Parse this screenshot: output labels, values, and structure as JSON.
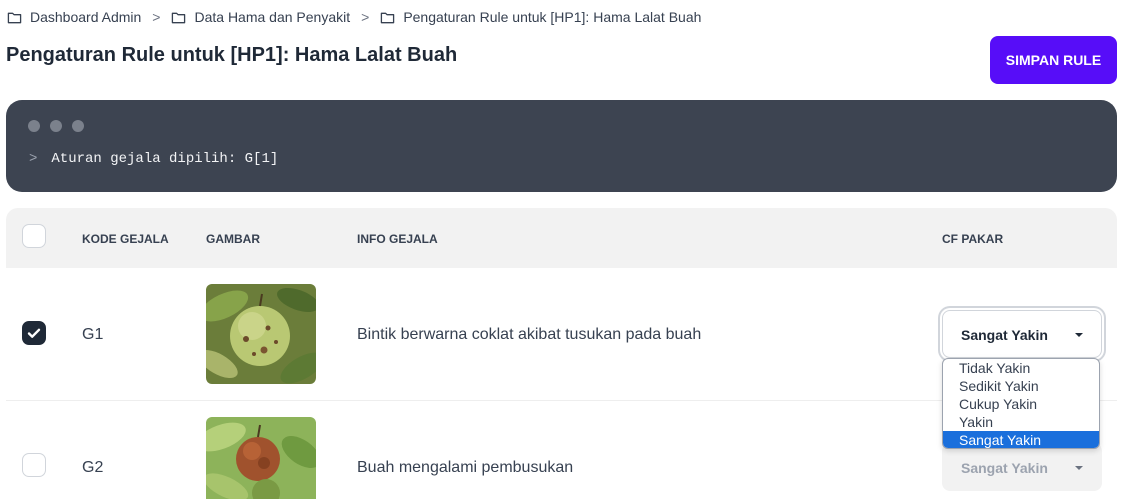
{
  "breadcrumb": [
    {
      "label": "Dashboard Admin",
      "icon": "folder-icon"
    },
    {
      "label": "Data Hama dan Penyakit",
      "icon": "folder-icon"
    },
    {
      "label": "Pengaturan Rule untuk [HP1]: Hama Lalat Buah",
      "icon": "folder-icon"
    }
  ],
  "page_title": "Pengaturan Rule untuk [HP1]: Hama Lalat Buah",
  "save_button": "SIMPAN RULE",
  "terminal": {
    "prompt": ">",
    "text": "Aturan gejala dipilih: G[1]"
  },
  "table": {
    "headers": {
      "code": "KODE GEJALA",
      "image": "GAMBAR",
      "info": "INFO GEJALA",
      "cf": "CF PAKAR"
    },
    "rows": [
      {
        "checked": true,
        "code": "G1",
        "info": "Bintik berwarna coklat akibat tusukan pada buah",
        "cf": "Sangat Yakin",
        "image": "guava-fruit-with-brown-spots"
      },
      {
        "checked": false,
        "code": "G2",
        "info": "Buah mengalami pembusukan",
        "cf": "Sangat Yakin",
        "image": "rotting-guava-fruit"
      }
    ]
  },
  "cf_options": [
    "Tidak Yakin",
    "Sedikit Yakin",
    "Cukup Yakin",
    "Yakin",
    "Sangat Yakin"
  ],
  "colors": {
    "accent": "#570df8",
    "terminal_bg": "#3d4451",
    "option_highlight": "#1a6fdc"
  }
}
